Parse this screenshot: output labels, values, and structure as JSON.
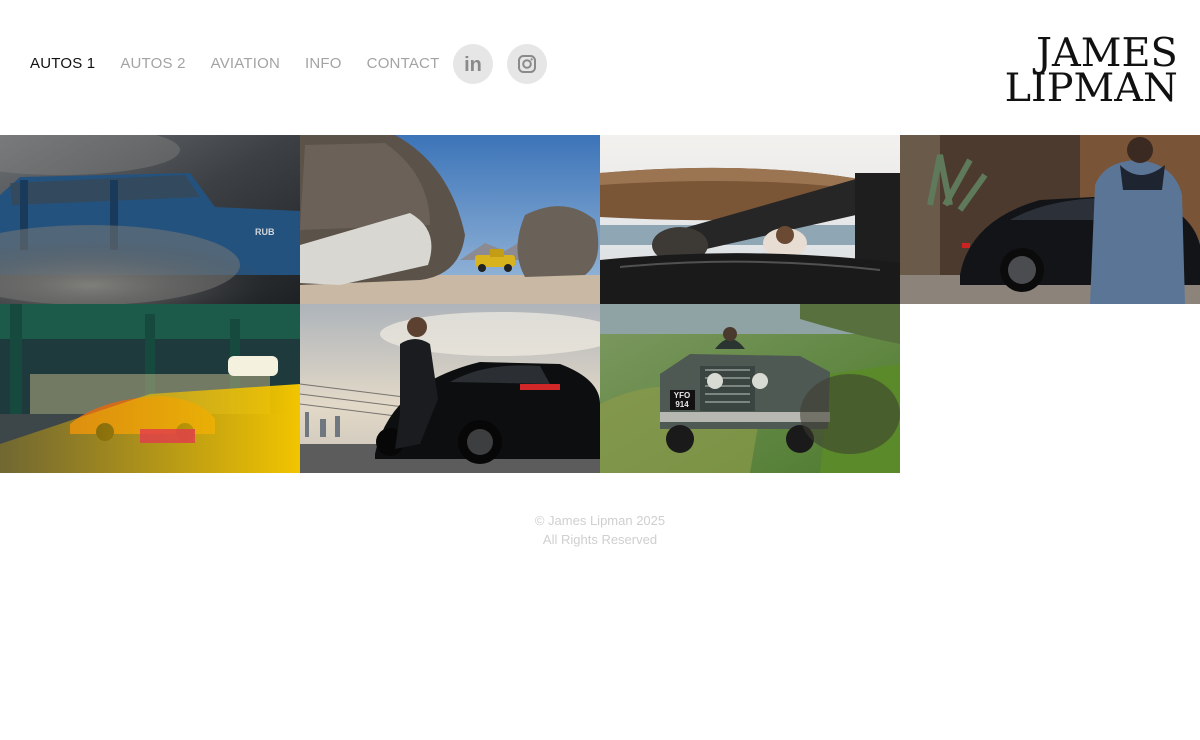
{
  "nav": {
    "items": [
      {
        "label": "AUTOS 1",
        "active": true
      },
      {
        "label": "AUTOS 2",
        "active": false
      },
      {
        "label": "AVIATION",
        "active": false
      },
      {
        "label": "INFO",
        "active": false
      },
      {
        "label": "CONTACT",
        "active": false
      }
    ],
    "social": [
      {
        "icon": "linkedin-icon",
        "label": "in"
      },
      {
        "icon": "instagram-icon"
      }
    ]
  },
  "logo": {
    "line1": "JAMES",
    "line2": "LIPMAN"
  },
  "gallery": {
    "photos": [
      {
        "subject": "blue-jeep-dust"
      },
      {
        "subject": "yellow-truck-boulders"
      },
      {
        "subject": "drivers-under-surfboard"
      },
      {
        "subject": "man-with-black-sedan"
      },
      {
        "subject": "orange-supercar-taxi-blur"
      },
      {
        "subject": "man-with-black-sportscar"
      },
      {
        "subject": "land-rover-grass",
        "plate_line1": "YFO",
        "plate_line2": "914"
      }
    ]
  },
  "footer": {
    "copyright": "© James Lipman 2025",
    "rights": "All Rights Reserved"
  },
  "colors": {
    "nav_active": "#111111",
    "nav_inactive": "#a3a3a3",
    "social_bg": "#e6e6e6",
    "footer_text": "#cfcfcf"
  }
}
